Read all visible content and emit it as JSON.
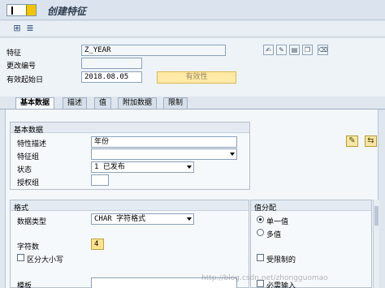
{
  "window": {
    "title": "创建特征"
  },
  "header": {
    "characteristic_label": "特征",
    "characteristic_value": "Z_YEAR",
    "change_number_label": "更改编号",
    "change_number_value": "",
    "valid_from_label": "有效起始日",
    "valid_from_value": "2018.08.05",
    "validity_button": "有效性"
  },
  "tabs": [
    "基本数据",
    "描述",
    "值",
    "附加数据",
    "限制"
  ],
  "basic_data": {
    "group_title": "基本数据",
    "description_label": "特性描述",
    "description_value": "年份",
    "group_label": "特征组",
    "group_value": "",
    "status_label": "状态",
    "status_value": "1 已发布",
    "auth_group_label": "授权组",
    "auth_group_value": ""
  },
  "format": {
    "group_title": "格式",
    "data_type_label": "数据类型",
    "data_type_value": "CHAR 字符格式",
    "num_chars_label": "字符数",
    "num_chars_value": "4",
    "case_sensitive_label": "区分大小写",
    "template_label": "模板",
    "template_value": ""
  },
  "value_assignment": {
    "group_title": "值分配",
    "single_value_label": "单一值",
    "multiple_values_label": "多值",
    "restricted_label": "受限制的",
    "required_label": "必需输入"
  },
  "watermark": "http://blog.csdn.net/zhongguomao",
  "icons": {
    "toolbar": [
      "hierarchy-icon",
      "display-icon"
    ],
    "header_buttons": [
      "signature-icon",
      "edit-icon",
      "document-icon",
      "copy-icon",
      "delete-icon"
    ],
    "side_buttons": [
      "edit-pencil-icon",
      "refresh-icon"
    ]
  }
}
